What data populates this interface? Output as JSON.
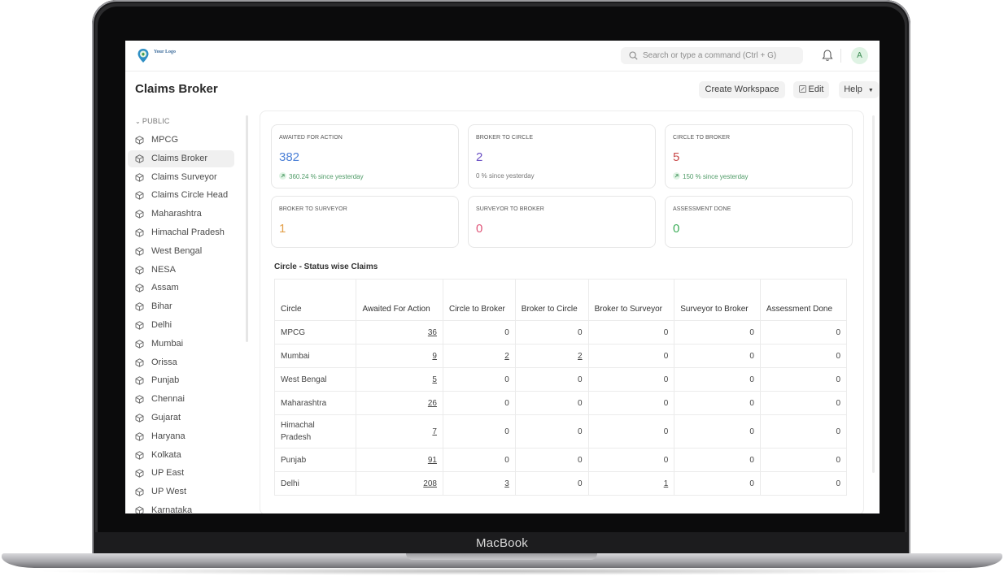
{
  "device": {
    "brand": "MacBook"
  },
  "app": {
    "logo_text": "Your Logo",
    "search_placeholder": "Search or type a command (Ctrl + G)",
    "avatar_initial": "A",
    "page_title": "Claims Broker",
    "buttons": {
      "create_workspace": "Create Workspace",
      "edit": "Edit",
      "help": "Help"
    }
  },
  "sidebar": {
    "section_label": "PUBLIC",
    "items": [
      {
        "label": "MPCG",
        "active": false
      },
      {
        "label": "Claims Broker",
        "active": true
      },
      {
        "label": "Claims Surveyor",
        "active": false
      },
      {
        "label": "Claims Circle Head",
        "active": false
      },
      {
        "label": "Maharashtra",
        "active": false
      },
      {
        "label": "Himachal Pradesh",
        "active": false
      },
      {
        "label": "West Bengal",
        "active": false
      },
      {
        "label": "NESA",
        "active": false
      },
      {
        "label": "Assam",
        "active": false
      },
      {
        "label": "Bihar",
        "active": false
      },
      {
        "label": "Delhi",
        "active": false
      },
      {
        "label": "Mumbai",
        "active": false
      },
      {
        "label": "Orissa",
        "active": false
      },
      {
        "label": "Punjab",
        "active": false
      },
      {
        "label": "Chennai",
        "active": false
      },
      {
        "label": "Gujarat",
        "active": false
      },
      {
        "label": "Haryana",
        "active": false
      },
      {
        "label": "Kolkata",
        "active": false
      },
      {
        "label": "UP East",
        "active": false
      },
      {
        "label": "UP West",
        "active": false
      },
      {
        "label": "Karnataka",
        "active": false
      }
    ]
  },
  "cards": [
    {
      "title": "AWAITED FOR ACTION",
      "value": "382",
      "color": "#4a7fd6",
      "sub": "360.24 % since yesterday",
      "trend": "up"
    },
    {
      "title": "BROKER TO CIRCLE",
      "value": "2",
      "color": "#6a4fc4",
      "sub": "0 % since yesterday",
      "trend": "flat"
    },
    {
      "title": "CIRCLE TO BROKER",
      "value": "5",
      "color": "#c94b4b",
      "sub": "150 % since yesterday",
      "trend": "up"
    },
    {
      "title": "BROKER TO SURVEYOR",
      "value": "1",
      "color": "#e3a04a",
      "sub": "",
      "trend": ""
    },
    {
      "title": "SURVEYOR TO BROKER",
      "value": "0",
      "color": "#e0577a",
      "sub": "",
      "trend": ""
    },
    {
      "title": "ASSESSMENT DONE",
      "value": "0",
      "color": "#3fae5a",
      "sub": "",
      "trend": ""
    }
  ],
  "table": {
    "title": "Circle - Status wise Claims",
    "headers": [
      "Circle",
      "Awaited For Action",
      "Circle to Broker",
      "Broker to Circle",
      "Broker to Surveyor",
      "Surveyor to Broker",
      "Assessment Done"
    ],
    "rows": [
      [
        "MPCG",
        "36",
        "0",
        "0",
        "0",
        "0",
        "0"
      ],
      [
        "Mumbai",
        "9",
        "2",
        "2",
        "0",
        "0",
        "0"
      ],
      [
        "West Bengal",
        "5",
        "0",
        "0",
        "0",
        "0",
        "0"
      ],
      [
        "Maharashtra",
        "26",
        "0",
        "0",
        "0",
        "0",
        "0"
      ],
      [
        "Himachal Pradesh",
        "7",
        "0",
        "0",
        "0",
        "0",
        "0"
      ],
      [
        "Punjab",
        "91",
        "0",
        "0",
        "0",
        "0",
        "0"
      ],
      [
        "Delhi",
        "208",
        "3",
        "0",
        "1",
        "0",
        "0"
      ]
    ]
  }
}
